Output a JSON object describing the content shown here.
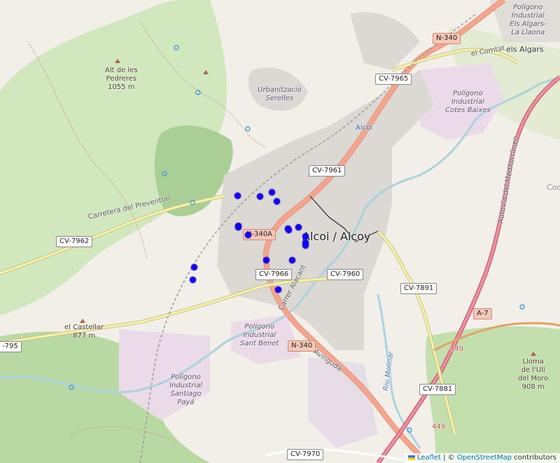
{
  "map": {
    "places": {
      "city": "Alcoi / Alcoy",
      "urb_serelles_1": "Urbanització",
      "urb_serelles_2": "Serelles",
      "alcoi_small": "Alcoi",
      "pi_algars_1": "Polígono",
      "pi_algars_2": "Industrial",
      "pi_algars_3": "Els Algars-",
      "pi_algars_4": "La Llaona",
      "els_algars": "els Algars",
      "pi_cotes_1": "Polígono",
      "pi_cotes_2": "Industrial",
      "pi_cotes_3": "Cotes Baixes",
      "pi_benet_1": "Polígono",
      "pi_benet_2": "Industrial",
      "pi_benet_3": "Sant Benet",
      "pi_santiago_1": "Polígono",
      "pi_santiago_2": "Industrial",
      "pi_santiago_3": "Santiago",
      "pi_santiago_4": "Payá",
      "cocentaina_part": "Coc"
    },
    "peaks": {
      "pedreres_1": "Alt de les",
      "pedreres_2": "Pedreres",
      "pedreres_3": "1055 m",
      "castellar_1": "el Castellar",
      "castellar_2": "877 m",
      "ull_1": "Lloma",
      "ull_2": "de l'Ull",
      "ull_3": "del Moro",
      "ull_4": "908 m"
    },
    "streets": {
      "preventori": "Carretera del Preventori",
      "alacant": "Carrer Alacant",
      "avinguda": "Avinguda",
      "autovia": "Autovía del Mediterráneo",
      "comtat": "el Comtat",
      "riu_molinar": "Riu Molinar"
    },
    "shields": {
      "n340_top": "N-340",
      "cv7965": "CV-7965",
      "cv7961": "CV-7961",
      "n340a": "N-340A",
      "cv7962": "CV-7962",
      "cv7966": "CV-7966",
      "cv7960": "CV-7960",
      "cv7891": "CV-7891",
      "a7": "A-7",
      "n340_bottom": "N-340",
      "cv7881": "CV-7881",
      "cv7970": "CV-7970",
      "cv795_part": "-795",
      "num449a": "449",
      "num449b": "449"
    },
    "markers": [
      {
        "lat": 38.7079,
        "lon": -0.4769
      },
      {
        "lat": 38.7078,
        "lon": -0.4733
      },
      {
        "lat": 38.7083,
        "lon": -0.4714
      },
      {
        "lat": 38.7072,
        "lon": -0.4706
      },
      {
        "lat": 38.7044,
        "lon": -0.4767
      },
      {
        "lat": 38.7042,
        "lon": -0.4768
      },
      {
        "lat": 38.7033,
        "lon": -0.4752
      },
      {
        "lat": 38.7041,
        "lon": -0.4688
      },
      {
        "lat": 38.7039,
        "lon": -0.4686
      },
      {
        "lat": 38.7042,
        "lon": -0.4671
      },
      {
        "lat": 38.7032,
        "lon": -0.4659
      },
      {
        "lat": 38.7024,
        "lon": -0.466
      },
      {
        "lat": 38.7021,
        "lon": -0.4659
      },
      {
        "lat": 38.7004,
        "lon": -0.4723
      },
      {
        "lat": 38.7004,
        "lon": -0.4681
      },
      {
        "lat": 38.6996,
        "lon": -0.4838
      },
      {
        "lat": 38.6981,
        "lon": -0.4841
      },
      {
        "lat": 38.697,
        "lon": -0.4703
      }
    ],
    "colors": {
      "marker": "#1300ff",
      "trunk_road": "#f3a58e",
      "secondary_road": "#f7f3a8",
      "water": "#aad3df",
      "forest": "#add19e",
      "industrial": "#ebdbe8"
    }
  },
  "attribution": {
    "leaflet": "Leaflet",
    "separator": " | © ",
    "osm": "OpenStreetMap",
    "suffix": " contributors"
  }
}
